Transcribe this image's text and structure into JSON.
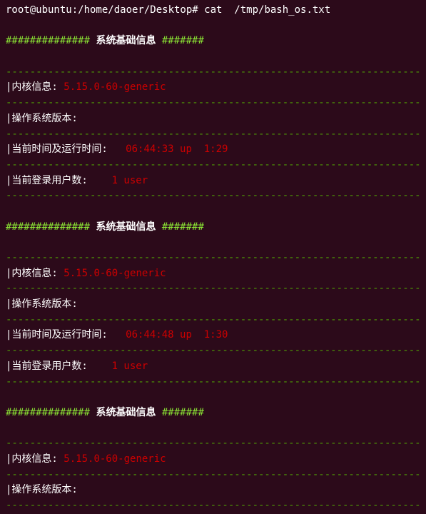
{
  "prompt": {
    "user_host_path": "root@ubuntu:/home/daoer/Desktop#",
    "command": "cat  /tmp/bash_os.txt"
  },
  "divider": "------------------------------------------------------------------------",
  "hash_prefix": "##############",
  "hash_suffix": "#######",
  "section_title": " 系统基础信息 ",
  "blocks": [
    {
      "kernel_label": "|内核信息: ",
      "kernel_value": "5.15.0-60-generic",
      "os_label": "|操作系统版本:",
      "time_label": "|当前时间及运行时间:   ",
      "time_value": "06:44:33 up  1:29",
      "users_label": "|当前登录用户数:    ",
      "users_value": "1 user"
    },
    {
      "kernel_label": "|内核信息: ",
      "kernel_value": "5.15.0-60-generic",
      "os_label": "|操作系统版本:",
      "time_label": "|当前时间及运行时间:   ",
      "time_value": "06:44:48 up  1:30",
      "users_label": "|当前登录用户数:    ",
      "users_value": "1 user"
    },
    {
      "kernel_label": "|内核信息: ",
      "kernel_value": "5.15.0-60-generic",
      "os_label": "|操作系统版本:"
    }
  ]
}
